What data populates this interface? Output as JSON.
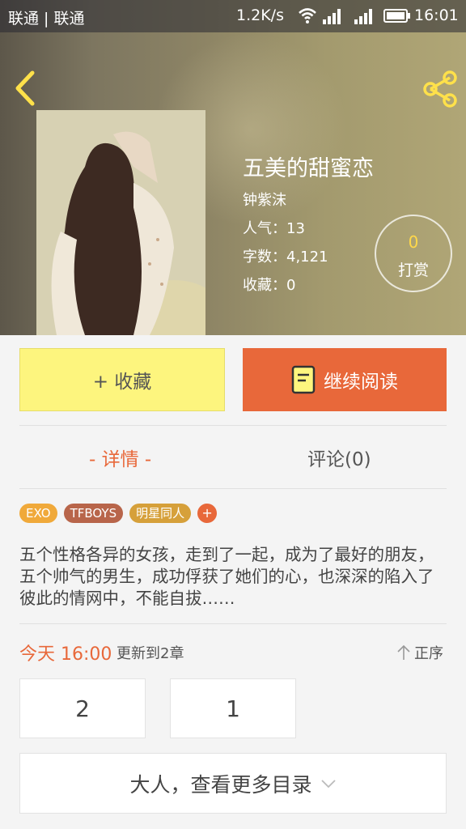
{
  "status_bar": {
    "carrier": "联通 | 联通",
    "speed": "1.2K/s",
    "time": "16:01"
  },
  "header": {
    "back_icon": "chevron-left-icon",
    "share_icon": "share-icon"
  },
  "book": {
    "title": "五美的甜蜜恋",
    "author": "钟紫沫",
    "popularity": "人气：13",
    "word_count": "字数：4,121",
    "favorites": "收藏：0"
  },
  "tip": {
    "count": "0",
    "label": "打赏"
  },
  "actions": {
    "collect_label": "+ 收藏",
    "read_label": "继续阅读"
  },
  "tabs": [
    {
      "label": "- 详情 -",
      "active": true
    },
    {
      "label": "评论(0)",
      "active": false
    }
  ],
  "tags": [
    {
      "label": "EXO",
      "color": "#f0a93a"
    },
    {
      "label": "TFBOYS",
      "color": "#b8654a"
    },
    {
      "label": "明星同人",
      "color": "#d6a03a"
    }
  ],
  "tag_add": "+",
  "description": "五个性格各异的女孩，走到了一起，成为了最好的朋友，五个帅气的男生，成功俘获了她们的心，也深深的陷入了彼此的情网中，不能自拔……",
  "update": {
    "time": "今天 16:00",
    "text": "更新到2章",
    "sort_label": "正序"
  },
  "chapters": [
    "2",
    "1"
  ],
  "more_catalog": "大人，查看更多目录",
  "colors": {
    "accent": "#e8683a",
    "collect_bg": "#fdf57e",
    "tip_count": "#ffd84a"
  }
}
